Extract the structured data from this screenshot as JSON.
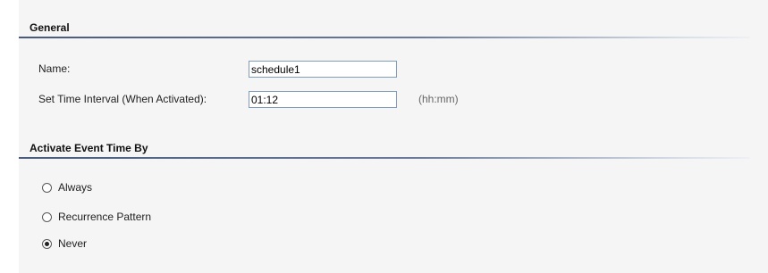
{
  "general": {
    "title": "General",
    "name_label": "Name:",
    "name_value": "schedule1",
    "interval_label": "Set Time Interval (When Activated):",
    "interval_value": "01:12",
    "interval_hint": "(hh:mm)"
  },
  "activate": {
    "title": "Activate Event Time By",
    "options": [
      {
        "label": "Always",
        "checked": false
      },
      {
        "label": "Recurrence Pattern",
        "checked": false
      },
      {
        "label": "Never",
        "checked": true
      }
    ]
  }
}
